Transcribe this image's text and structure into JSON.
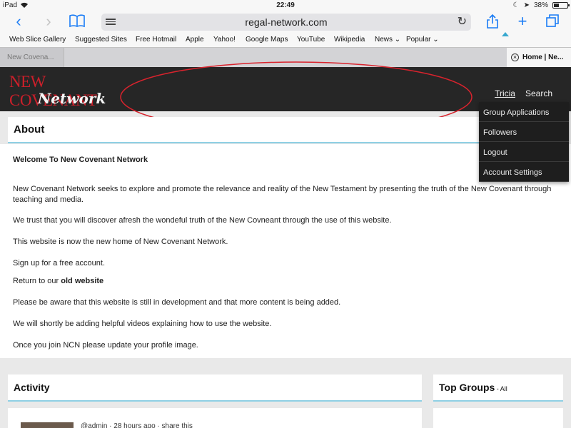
{
  "status_bar": {
    "device": "iPad",
    "time": "22:49",
    "battery": "38%",
    "battery_level": 0.38
  },
  "toolbar": {
    "url": "regal-network.com"
  },
  "bookmarks": [
    "Web Slice Gallery",
    "Suggested Sites",
    "Free Hotmail",
    "Apple",
    "Yahoo!",
    "Google Maps",
    "YouTube",
    "Wikipedia",
    "News ⌄",
    "Popular ⌄"
  ],
  "tabs": {
    "inactive": "New Covena...",
    "active": "Home | Ne..."
  },
  "site": {
    "logo_line1": "NEW COVENANT",
    "logo_line2": "Network",
    "nav": {
      "user": "Tricia",
      "search": "Search"
    },
    "dropdown": [
      "Group Applications",
      "Followers",
      "Logout",
      "Account Settings"
    ]
  },
  "about": {
    "heading": "About",
    "welcome": "Welcome To New Covenant Network",
    "p1": "New Covenant Network seeks to explore and promote the relevance and reality of the New Testament by presenting the truth of the New Covenant through teaching and media.",
    "p2": "We trust that you will discover afresh the wondeful truth of the New Covneant through the use of this website.",
    "p3": "This website is now the new home of New Covenant Network.",
    "p4": "Sign up for a free account.",
    "p5_prefix": "Return to our ",
    "p5_link": "old website",
    "p6": "Please be aware that this website is still in development and that more content is being added.",
    "p7": "We will shortly be adding helpful videos explaining how to use the website.",
    "p8": "Once you join NCN please update your profile image."
  },
  "activity": {
    "heading": "Activity",
    "meta": "@admin · 28 hours ago · share this"
  },
  "groups": {
    "heading": "Top Groups",
    "all": " - All"
  },
  "colors": {
    "accent": "#1a7cf5",
    "logo_red": "#cc1f2a",
    "header_bg": "#262626",
    "underline": "#8fd0e4",
    "annotation": "#d9232d"
  }
}
